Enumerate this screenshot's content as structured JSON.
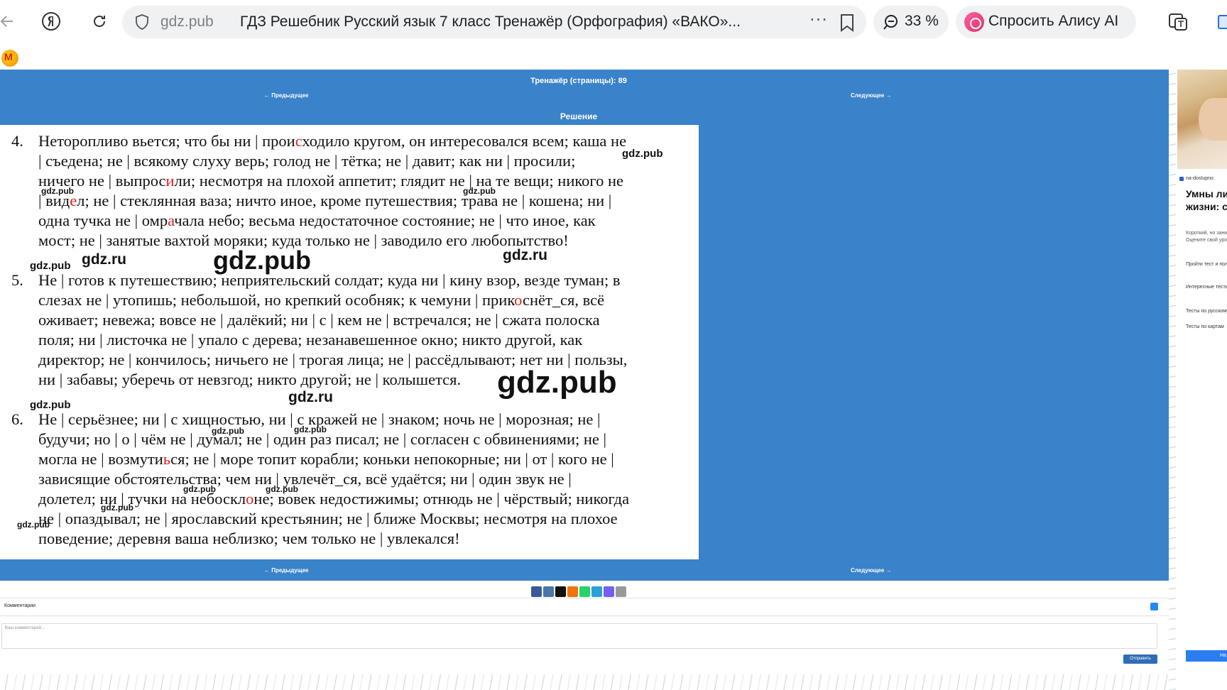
{
  "browser": {
    "domain": "gdz.pub",
    "tab_title": "ГДЗ Решебник Русский язык 7 класс Тренажёр (Орфография) «ВАКО»...",
    "more": "···",
    "zoom": "33 %",
    "alice_label": "Спросить Алису AI"
  },
  "page": {
    "title": "Тренажёр (страницы): 89",
    "prev": "← Предыдущее",
    "next": "Следующее →",
    "solution_label": "Решение"
  },
  "solution": {
    "items": [
      {
        "number": "4.",
        "lines": [
          "Неторопливо вьется; что бы ни | прои|с|ходило кругом, он интересовался всем; каша не",
          "| съедена; не | всякому слуху верь; голод не | тётка; не | давит; как ни  | просили;",
          "ничего не | выпрос|и|ли; несмотря на плохой аппетит; глядит не | на те вещи; никого не",
          "| вид|е|л; не | стеклянная ваза; ничто иное, кроме путешествия; трава не | кошена; ни |",
          "одна тучка не | омр|а|чала небо; весьма недостаточное состояние; не | что иное, как",
          "мост; не | занятые вахтой моряки; куда только не | заводило его любопытство!"
        ]
      },
      {
        "number": "5.",
        "lines": [
          "Не | готов к путешествию; неприятельский солдат; куда ни | кину взор, везде туман; в",
          "слезах не | утопишь; небольшой, но крепкий особняк; к чемуни | прик|о|снёт_ся, всё",
          "оживает; невежа; вовсе не | далёкий; ни | с | кем не | встречался; не | сжата полоска",
          "поля; ни | листочка не | упало с дерева; незанавешенное окно; никто другой, как",
          "директор; не | кончилось; ничьего не | трогая лица; не | рассёдлывают; нет ни | пользы,",
          "ни | забавы; уберечь от невзгод; никто другой; не | колышется."
        ]
      },
      {
        "number": "6.",
        "lines": [
          "Не | серьёзнее; ни  | с хищностью, ни | с кражей не | знаком; ночь не | морозная; не |",
          "будучи; но | о | чём не | думал; не | один раз писал; не | согласен с обвинениями; не |",
          "могла не | возмути|ь|ся; не | море топит корабли; коньки непокорные; ни | от | кого не |",
          "зависящие обстоятельства; чем ни | увлечёт_ся, всё удаётся; ни | один звук не |",
          "долетел; ни | тучки на небоскл|о|не; вовек недостижимы; отнюдь не | чёрствый; никогда",
          "не | опаздывал; не | ярославский крестьянин; не | ближе Москвы; несмотря на плохое",
          "поведение; деревня ваша неблизко; чем только не | увлекался!"
        ]
      }
    ],
    "watermarks": {
      "pub": "gdz.pub",
      "ru": "gdz.ru"
    }
  },
  "share_colors": [
    "#3b5998",
    "#4a76a8",
    "#111111",
    "#f2720c",
    "#25d366",
    "#2aa1da",
    "#7360f2",
    "#999999"
  ],
  "comments": {
    "label": "Комментарии",
    "placeholder": "Ваш комментарий...",
    "send": "Отправить"
  },
  "ad": {
    "source": "na-dostupno",
    "headline": "Умны ли вы по жизни: секунды",
    "description": "Короткий, но занимательный тест. Оцените свой уровень интеллекта!",
    "links": [
      "Пройти тест и получить подарок",
      "Интересные тесты на эрудицию",
      "Тесты по русскому",
      "Тесты по картам"
    ],
    "button": "На"
  }
}
